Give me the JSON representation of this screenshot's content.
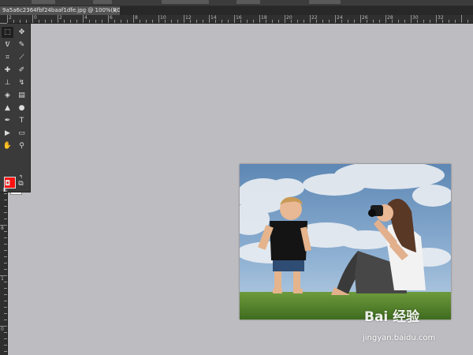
{
  "document": {
    "tab_title": "9a5a6c2364fbf24baaf1dfe.jpg @ 100%(RGB/8#)",
    "close_glyph": "×"
  },
  "ruler_top_labels": [
    "2",
    "0",
    "2",
    "4",
    "6",
    "8",
    "10",
    "12",
    "14",
    "16",
    "18",
    "20",
    "22",
    "24",
    "26",
    "28",
    "30",
    "32"
  ],
  "ruler_left_labels": [
    "0",
    "2",
    "4",
    "6",
    "8",
    "1",
    "0"
  ],
  "tools": [
    {
      "name": "marquee-tool-icon",
      "glyph": "⬚",
      "active": true
    },
    {
      "name": "move-tool-icon",
      "glyph": "✥"
    },
    {
      "name": "lasso-tool-icon",
      "glyph": "ᕓ"
    },
    {
      "name": "quick-select-tool-icon",
      "glyph": "✎"
    },
    {
      "name": "crop-tool-icon",
      "glyph": "⌗"
    },
    {
      "name": "eyedropper-tool-icon",
      "glyph": "⟋"
    },
    {
      "name": "healing-brush-tool-icon",
      "glyph": "✚"
    },
    {
      "name": "brush-tool-icon",
      "glyph": "✐"
    },
    {
      "name": "clone-stamp-tool-icon",
      "glyph": "⊥"
    },
    {
      "name": "history-brush-tool-icon",
      "glyph": "↯"
    },
    {
      "name": "eraser-tool-icon",
      "glyph": "◈"
    },
    {
      "name": "gradient-tool-icon",
      "glyph": "▤"
    },
    {
      "name": "blur-tool-icon",
      "glyph": "▲"
    },
    {
      "name": "dodge-tool-icon",
      "glyph": "●"
    },
    {
      "name": "pen-tool-icon",
      "glyph": "✒"
    },
    {
      "name": "type-tool-icon",
      "glyph": "T"
    },
    {
      "name": "path-select-tool-icon",
      "glyph": "▶"
    },
    {
      "name": "shape-tool-icon",
      "glyph": "▭"
    },
    {
      "name": "hand-tool-icon",
      "glyph": "✋"
    },
    {
      "name": "zoom-tool-icon",
      "glyph": "⚲"
    }
  ],
  "colors": {
    "foreground": "#ff1010",
    "background": "#ffffff"
  },
  "swap_glyph": "↰",
  "reset_glyph": "◧",
  "bottom_tools": [
    {
      "name": "quick-mask-icon",
      "glyph": "◘"
    },
    {
      "name": "screen-mode-icon",
      "glyph": "⧉"
    }
  ],
  "watermark": {
    "logo_text": "Bai  经验",
    "url": "jingyan.baidu.com"
  }
}
